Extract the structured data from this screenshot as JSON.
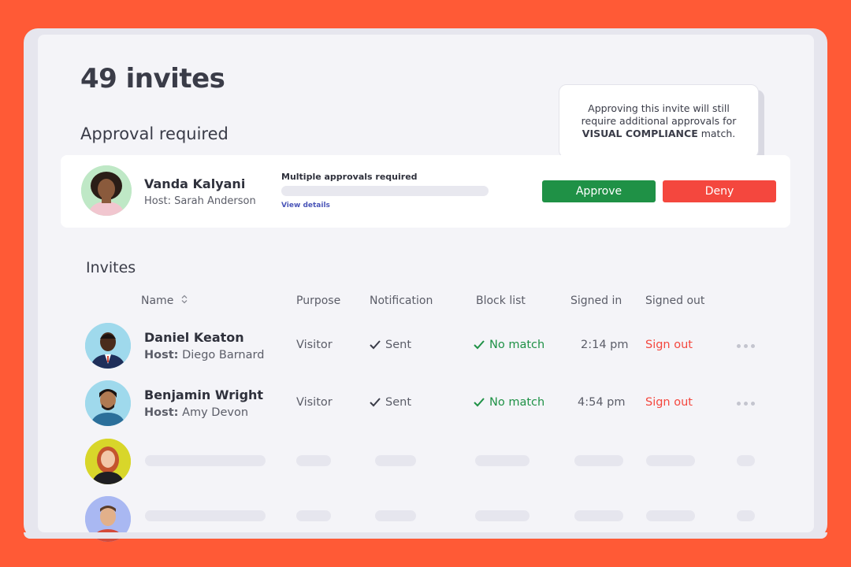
{
  "page": {
    "title": "49 invites",
    "section_title": "Approval required"
  },
  "tooltip": {
    "line1": "Approving this invite will still",
    "line2": "require additional approvals for",
    "emphasis": "VISUAL COMPLIANCE",
    "suffix": " match."
  },
  "approval": {
    "name": "Vanda Kalyani",
    "host": "Host: Sarah Anderson",
    "status_label": "Multiple approvals required",
    "progress": 0,
    "view_details": "View details",
    "approve_label": "Approve",
    "deny_label": "Deny"
  },
  "invites": {
    "title": "Invites",
    "columns": {
      "name": "Name",
      "purpose": "Purpose",
      "notification": "Notification",
      "block_list": "Block list",
      "signed_in": "Signed in",
      "signed_out": "Signed out"
    },
    "rows": [
      {
        "name": "Daniel Keaton",
        "host_label": "Host:",
        "host": "Diego Barnard",
        "purpose": "Visitor",
        "notification": "Sent",
        "block_list": "No match",
        "signed_in": "2:14 pm",
        "signed_out": "Sign out"
      },
      {
        "name": "Benjamin Wright",
        "host_label": "Host:",
        "host": "Amy Devon",
        "purpose": "Visitor",
        "notification": "Sent",
        "block_list": "No match",
        "signed_in": "4:54 pm",
        "signed_out": "Sign out"
      }
    ]
  },
  "colors": {
    "background": "#FF5A36",
    "approve": "#1f9146",
    "deny": "#f4473e",
    "link": "#4a55b8"
  }
}
